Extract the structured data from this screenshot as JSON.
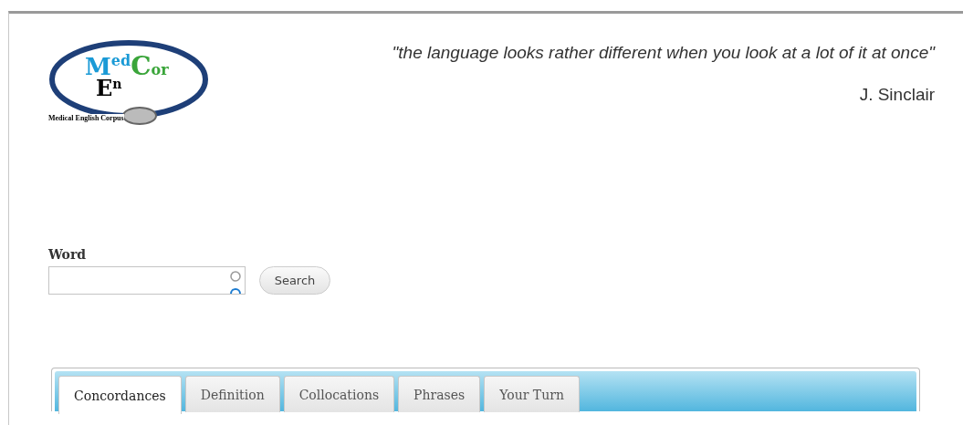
{
  "logo": {
    "parts": [
      "M",
      "ed",
      "C",
      "or",
      "E",
      "n"
    ],
    "caption": "Medical English Corpus"
  },
  "quote": {
    "text": "\"the language looks rather different when you look at a lot of it at once\"",
    "author": "J. Sinclair"
  },
  "search": {
    "label": "Word",
    "button": "Search"
  },
  "tabs": [
    {
      "label": "Concordances",
      "selected": true
    },
    {
      "label": "Definition",
      "selected": false
    },
    {
      "label": "Collocations",
      "selected": false
    },
    {
      "label": "Phrases",
      "selected": false
    },
    {
      "label": "Your Turn",
      "selected": false
    }
  ]
}
